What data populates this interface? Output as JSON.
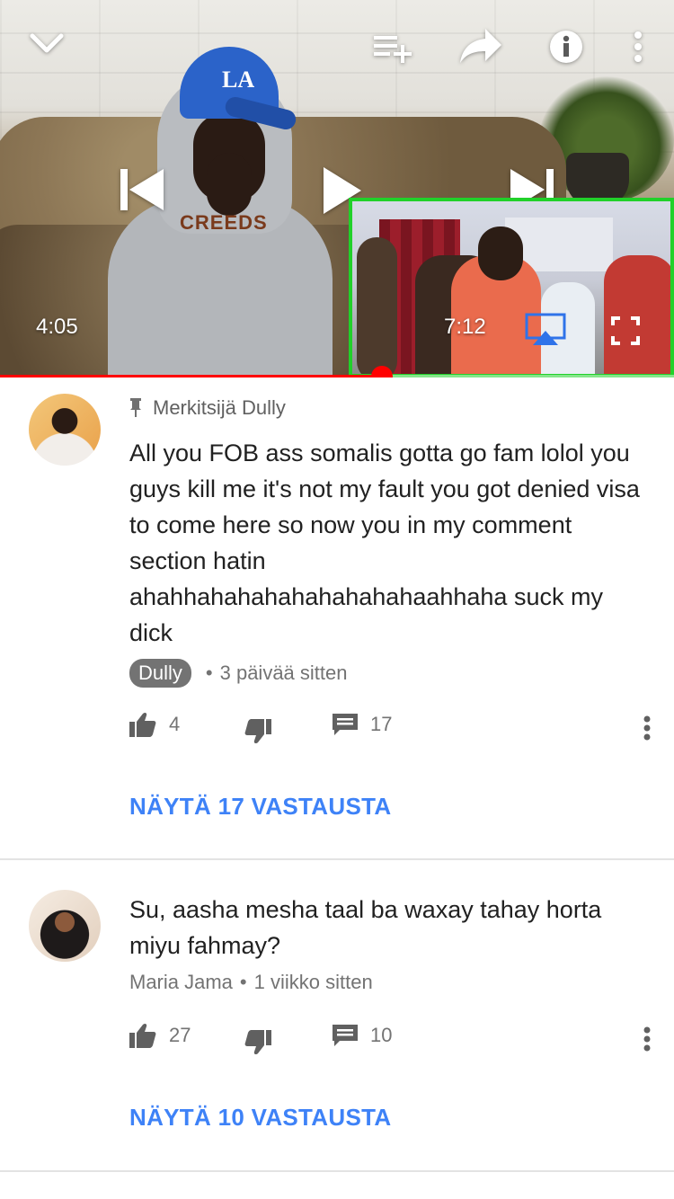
{
  "player": {
    "current_time": "4:05",
    "progress_fraction": 0.566,
    "next_video": {
      "duration": "7:12"
    },
    "controls": {
      "collapse_icon": "chevron-down-icon",
      "add_to_playlist_icon": "playlist-add-icon",
      "share_icon": "share-icon",
      "info_icon": "info-icon",
      "more_icon": "more-vertical-icon",
      "previous_icon": "skip-previous-icon",
      "play_icon": "play-icon",
      "next_icon": "skip-next-icon",
      "airplay_icon": "airplay-icon",
      "fullscreen_icon": "fullscreen-icon"
    },
    "colors": {
      "progress": "#ff0000",
      "mini_border": "#21d12a"
    }
  },
  "comments": [
    {
      "pinned_label": "Merkitsijä Dully",
      "text": "All you FOB ass somalis gotta go fam lolol you guys kill me it's not my fault you got denied visa to come here so now you in my comment section hatin ahahhahahahahahahahahaahhaha suck my dick",
      "author": "Dully",
      "time": "3 päivää sitten",
      "likes": "4",
      "replies": "17",
      "view_replies": "NÄYTÄ 17 VASTAUSTA"
    },
    {
      "text": "Su, aasha mesha taal ba waxay tahay horta miyu fahmay?",
      "author": "Maria Jama",
      "time": "1 viikko sitten",
      "likes": "27",
      "replies": "10",
      "view_replies": "NÄYTÄ 10 VASTAUSTA"
    }
  ],
  "colors": {
    "link": "#3e82f7",
    "meta_text": "#737373"
  }
}
